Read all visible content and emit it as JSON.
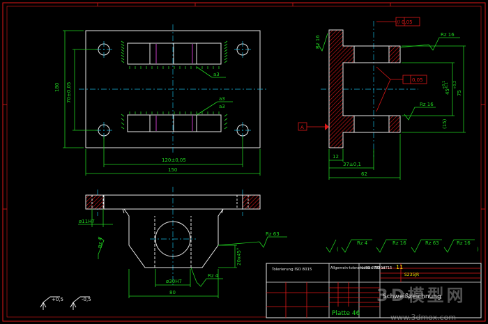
{
  "front_view": {
    "dim_height": "180",
    "dim_hole_spacing_v": "70±0,05",
    "dim_hole_spacing_h": "120±0,05",
    "dim_width": "150",
    "weld_a3_top": "a3",
    "weld_a3_mid_1": "a3",
    "weld_a3_mid_2": "a3"
  },
  "section_view": {
    "rz_top_left": "Rz 16",
    "rz_top_right": "Rz 16",
    "rz_mid": "Rz 16",
    "parallel_box": "// 0,05",
    "flatness_box": "0,05",
    "datum_a": "A",
    "dim_45": "45",
    "dim_45_tol_upper": "+0,1",
    "dim_45_tol_lower": "-0,1",
    "dim_75": "75",
    "dim_75_tol": "+0,2",
    "dim_15": "(15)",
    "dim_12": "12",
    "dim_37": "37±0,1",
    "dim_62": "62"
  },
  "bottom_view": {
    "hole_fit": "ø11H7",
    "rz4_left": "Rz 4",
    "rz63": "Rz 63",
    "chamfer": "20x45°",
    "bore_fit": "ø30H7",
    "rz4_bottom": "Rz 4",
    "dim_80": "80"
  },
  "surface_legend": [
    "Rz 4",
    "Rz 16",
    "Rz 63",
    "Rz 16"
  ],
  "axis_symbol_left": "+0,5",
  "axis_symbol_right": "-0,5",
  "title_block": {
    "general_tolerance": "Tolerierung ISO 8015",
    "general_tol_label": "Allgemein-toleranz ISO 2768-m",
    "edge_label": "Kanten ISO 13715",
    "sheet_number": "11",
    "material_code": "S235JR",
    "drawing_title": "Schweißzeichnung",
    "part_name": "Platte 46"
  },
  "watermark": {
    "text": "3D模型网",
    "url": "www.3dmox.com"
  }
}
